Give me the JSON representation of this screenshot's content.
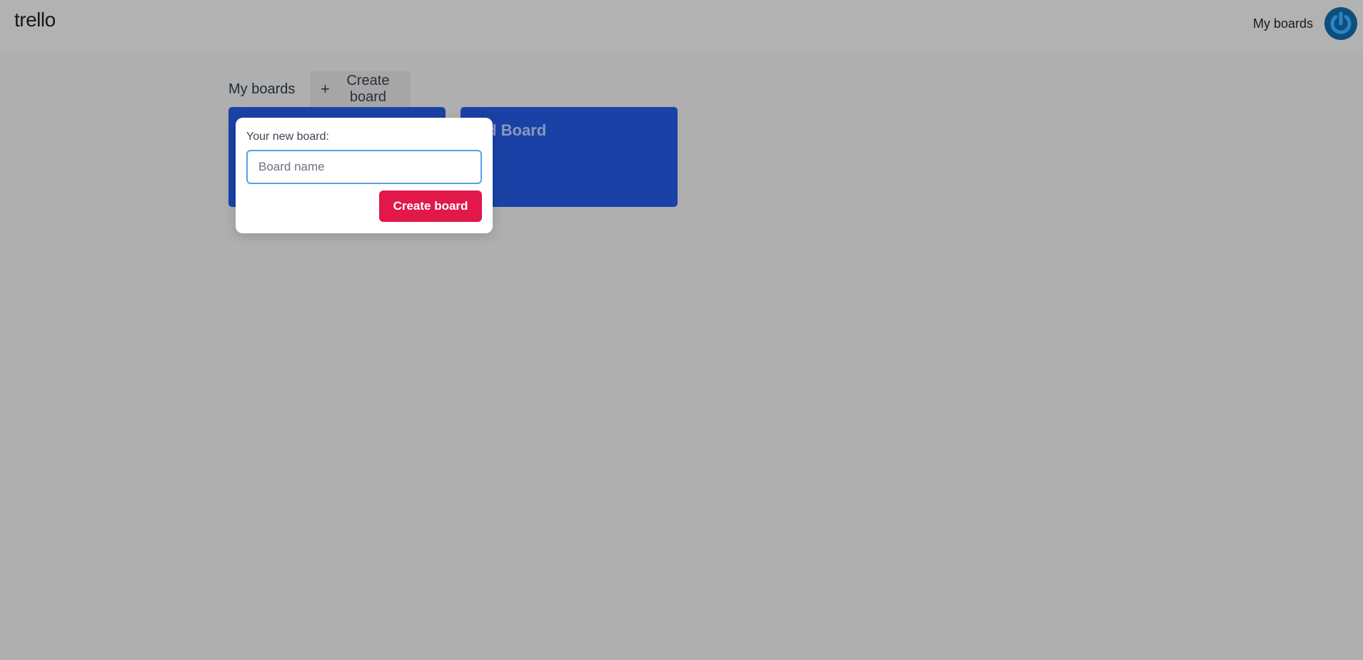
{
  "topbar": {
    "logo": "trello",
    "my_boards_label": "My boards",
    "avatar_icon": "power-icon"
  },
  "main": {
    "section_title": "My boards",
    "create_board_label": "Create board",
    "boards": [
      {
        "title": ""
      },
      {
        "title": "cond Board"
      }
    ]
  },
  "popover": {
    "label": "Your new board:",
    "input_value": "",
    "input_placeholder": "Board name",
    "submit_label": "Create board"
  },
  "colors": {
    "board_blue": "#1a42a6",
    "accent_red": "#e2184b",
    "avatar_blue": "#0e4e7e",
    "overlay_gray": "#aeafae"
  }
}
